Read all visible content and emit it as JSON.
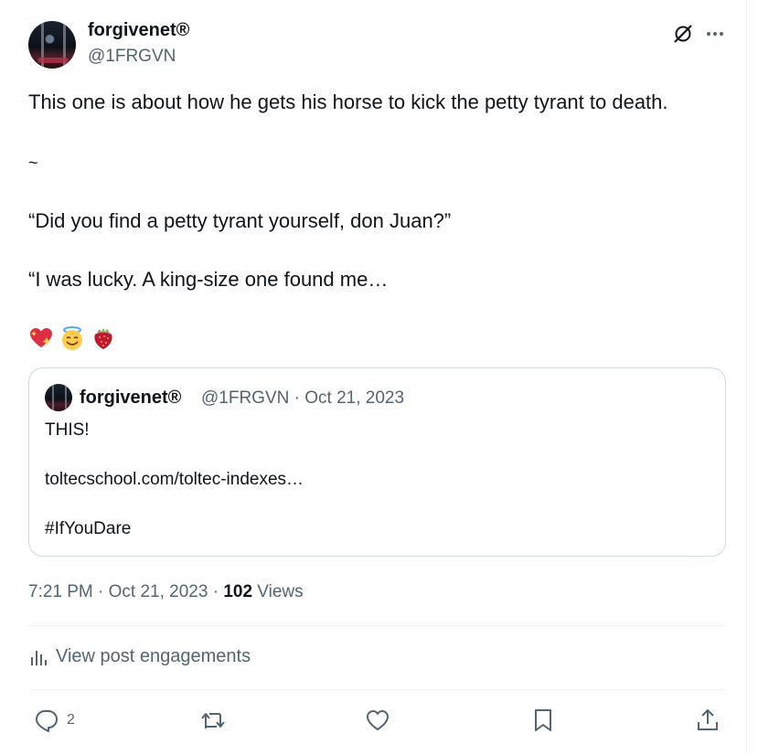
{
  "post": {
    "author_name": "forgivenet®",
    "author_handle": "@1FRGVN",
    "lines": [
      "This one is about how he gets his horse to kick the petty tyrant to death.",
      "~",
      "“Did you find a petty tyrant yourself, don Juan?”",
      "“I was lucky. A king-size one found me…"
    ],
    "emojis": [
      "sparkling-heart",
      "smiling-face-with-halo",
      "strawberry"
    ]
  },
  "quote": {
    "author_name": "forgivenet®",
    "meta": "@1FRGVN · Oct 21, 2023",
    "lines": [
      "THIS!",
      "toltecschool.com/toltec-indexes…",
      "#IfYouDare"
    ]
  },
  "timestamp": {
    "time_date": "7:21 PM · Oct 21, 2023 · ",
    "views_count": "102",
    "views_label": " Views"
  },
  "engagements_label": "View post engagements",
  "actions": {
    "reply_count": "2",
    "icons": [
      "reply-icon",
      "repost-icon",
      "like-icon",
      "bookmark-icon",
      "share-icon"
    ]
  },
  "colors": {
    "text": "#0f1419",
    "muted": "#536471",
    "border": "#cfd9de",
    "divider": "#eff3f4"
  }
}
